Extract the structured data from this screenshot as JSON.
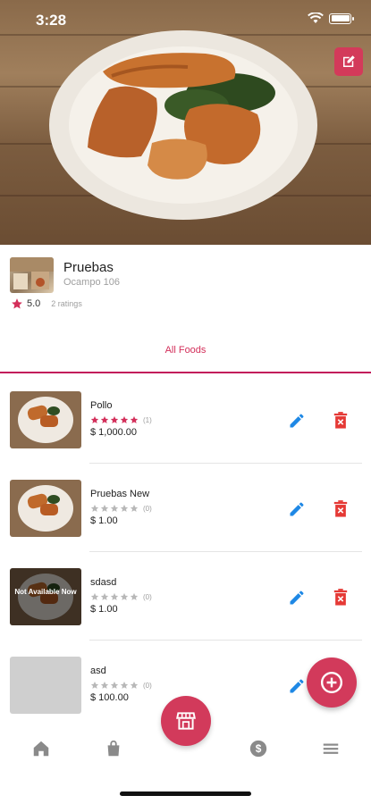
{
  "status_bar": {
    "time": "3:28"
  },
  "restaurant": {
    "name": "Pruebas",
    "address": "Ocampo 106",
    "rating": "5.0",
    "ratings_count": "2 ratings"
  },
  "tabs": [
    {
      "label": "All Foods",
      "selected": true
    }
  ],
  "foods": [
    {
      "name": "Pollo",
      "rating": 5,
      "rating_count": "(1)",
      "price": "$ 1,000.00",
      "available": true,
      "has_image": true
    },
    {
      "name": "Pruebas New",
      "rating": 0,
      "rating_count": "(0)",
      "price": "$ 1.00",
      "available": true,
      "has_image": true
    },
    {
      "name": "sdasd",
      "rating": 0,
      "rating_count": "(0)",
      "price": "$ 1.00",
      "available": false,
      "has_image": true,
      "unavailable_label": "Not Available Now"
    },
    {
      "name": "asd",
      "rating": 0,
      "rating_count": "(0)",
      "price": "$ 100.00",
      "available": true,
      "has_image": false
    }
  ],
  "icons": {
    "hero_action": "edit-square-icon",
    "row_edit": "pencil-icon",
    "row_delete": "trash-icon",
    "fab": "add-circle-icon",
    "nav": [
      "home-icon",
      "shopping-bag-icon",
      "store-icon",
      "dollar-icon",
      "menu-icon"
    ]
  },
  "colors": {
    "accent": "#d23a5b",
    "star_filled": "#d32f5a",
    "star_empty": "#b8b8b8",
    "edit_blue": "#1e88e5",
    "delete_red": "#e53935",
    "nav_grey": "#8a8a8a"
  }
}
